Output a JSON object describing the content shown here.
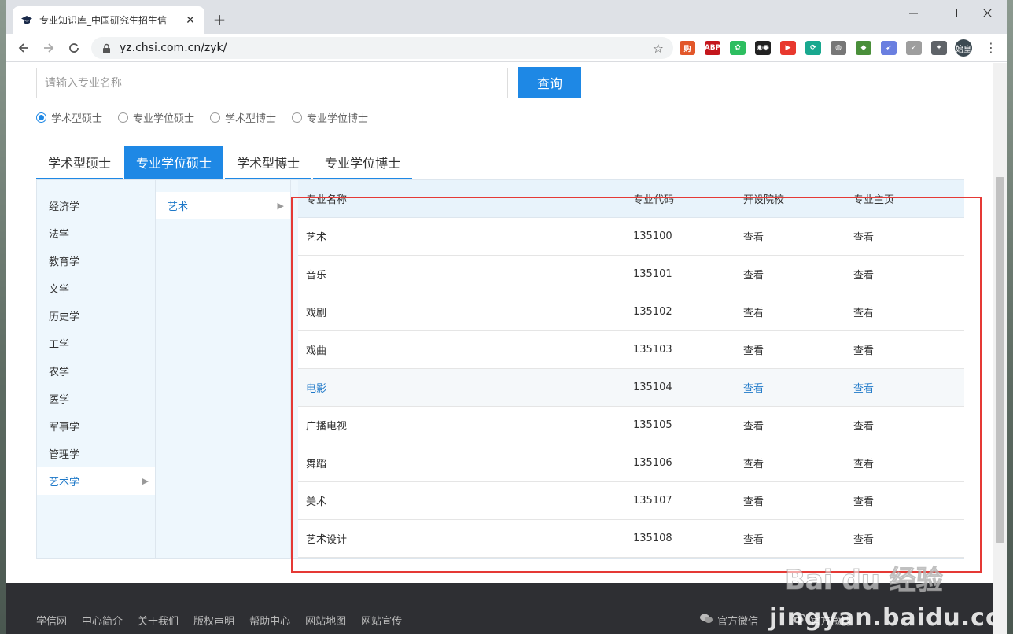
{
  "browser": {
    "tab_title": "专业知识库_中国研究生招生信",
    "tab_close": "✕",
    "new_tab": "+",
    "url": "yz.chsi.com.cn/zyk/",
    "profile_label": "始皇",
    "extensions": [
      {
        "name": "shopping-ext",
        "label": "购",
        "color": "#e2572a"
      },
      {
        "name": "adblock-ext",
        "label": "ABP",
        "color": "#c4161c"
      },
      {
        "name": "evernote-ext",
        "label": "✿",
        "color": "#2dbe60"
      },
      {
        "name": "glasses-ext",
        "label": "◉◉",
        "color": "#222222"
      },
      {
        "name": "video-ext",
        "label": "▶",
        "color": "#e8382e"
      },
      {
        "name": "sync-ext",
        "label": "⟳",
        "color": "#19a88f"
      },
      {
        "name": "bulb-ext",
        "label": "◍",
        "color": "#777777"
      },
      {
        "name": "globe-ext",
        "label": "◆",
        "color": "#4a8f3a"
      },
      {
        "name": "bird-ext",
        "label": "➹",
        "color": "#6a7fe0"
      },
      {
        "name": "check-ext",
        "label": "✓",
        "color": "#9e9e9e"
      },
      {
        "name": "puzzle-ext",
        "label": "✦",
        "color": "#5f6368"
      }
    ]
  },
  "search": {
    "placeholder": "请输入专业名称",
    "button": "查询",
    "radios": [
      {
        "label": "学术型硕士",
        "checked": true
      },
      {
        "label": "专业学位硕士",
        "checked": false
      },
      {
        "label": "学术型博士",
        "checked": false
      },
      {
        "label": "专业学位博士",
        "checked": false
      }
    ]
  },
  "degree_tabs": [
    {
      "label": "学术型硕士",
      "active": false
    },
    {
      "label": "专业学位硕士",
      "active": true
    },
    {
      "label": "学术型博士",
      "active": false
    },
    {
      "label": "专业学位博士",
      "active": false
    }
  ],
  "categories": [
    "经济学",
    "法学",
    "教育学",
    "文学",
    "历史学",
    "工学",
    "农学",
    "医学",
    "军事学",
    "管理学",
    "艺术学"
  ],
  "active_category": "艺术学",
  "subcategory": "艺术",
  "arrow_glyph": "▶",
  "table": {
    "headers": {
      "name": "专业名称",
      "code": "专业代码",
      "school": "开设院校",
      "home": "专业主页"
    },
    "rows": [
      {
        "name": "艺术",
        "code": "135100",
        "school": "查看",
        "home": "查看"
      },
      {
        "name": "音乐",
        "code": "135101",
        "school": "查看",
        "home": "查看"
      },
      {
        "name": "戏剧",
        "code": "135102",
        "school": "查看",
        "home": "查看"
      },
      {
        "name": "戏曲",
        "code": "135103",
        "school": "查看",
        "home": "查看"
      },
      {
        "name": "电影",
        "code": "135104",
        "school": "查看",
        "home": "查看"
      },
      {
        "name": "广播电视",
        "code": "135105",
        "school": "查看",
        "home": "查看"
      },
      {
        "name": "舞蹈",
        "code": "135106",
        "school": "查看",
        "home": "查看"
      },
      {
        "name": "美术",
        "code": "135107",
        "school": "查看",
        "home": "查看"
      },
      {
        "name": "艺术设计",
        "code": "135108",
        "school": "查看",
        "home": "查看"
      }
    ],
    "hover_row": 4
  },
  "footer": {
    "links": [
      "学信网",
      "中心简介",
      "关于我们",
      "版权声明",
      "帮助中心",
      "网站地图",
      "网站宣传"
    ],
    "wechat": "官方微信",
    "weibo": "官方微博"
  },
  "watermark": {
    "logo": "Bai du 经验",
    "text": "jingyan.baidu.com"
  },
  "colors": {
    "accent": "#1e88e5",
    "link": "#1e78c8",
    "highlight": "#e53935",
    "footer": "#2e2f33"
  }
}
